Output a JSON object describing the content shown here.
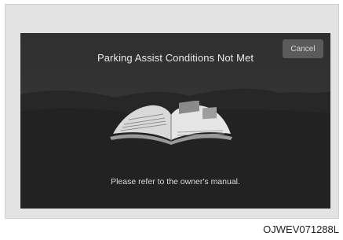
{
  "dialog": {
    "title": "Parking Assist Conditions Not Met",
    "cancel_label": "Cancel",
    "message": "Please refer to the owner's manual."
  },
  "figure_code": "OJWEV071288L",
  "icons": {
    "book": "open-book-icon"
  }
}
